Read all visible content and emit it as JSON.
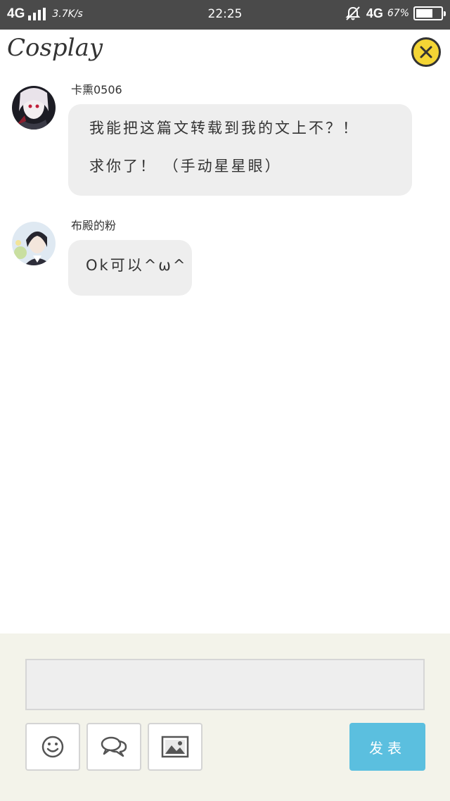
{
  "status_bar": {
    "network_left": "4G",
    "speed": "3.7K/s",
    "time": "22:25",
    "network_right": "4G",
    "battery_percent_text": "67%",
    "battery_level": 0.67,
    "icons": [
      "signal-bars-icon",
      "alarm-off-icon",
      "battery-icon"
    ]
  },
  "header": {
    "title": "Cosplay",
    "close_icon": "close-icon",
    "accent_color": "#f4d535"
  },
  "messages": [
    {
      "username": "卡熏0506",
      "lines": [
        "我能把这篇文转载到我的文上不？！",
        "求你了！  （手动星星眼）"
      ]
    },
    {
      "username": "布殿的粉",
      "lines": [
        "Ok可以^ω^"
      ]
    }
  ],
  "composer": {
    "input_value": "",
    "tools": [
      "emoji-icon",
      "chat-bubbles-icon",
      "image-icon"
    ],
    "send_label": "发表",
    "send_color": "#5bbfdf"
  }
}
